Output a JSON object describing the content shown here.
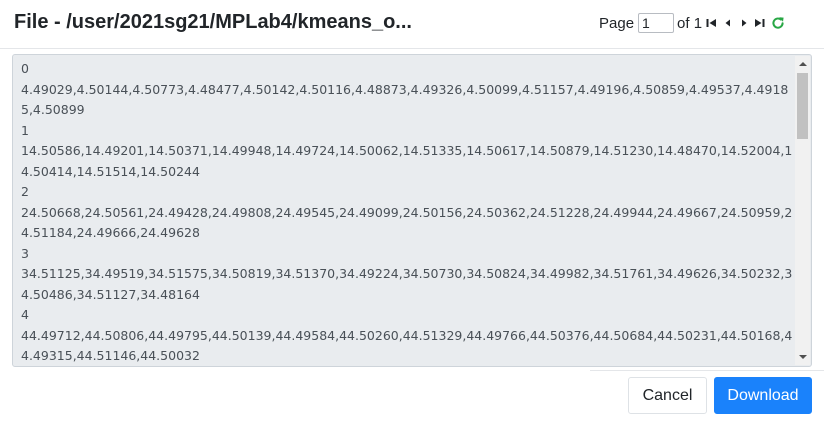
{
  "dialog": {
    "title": "File - /user/2021sg21/MPLab4/kmeans_o..."
  },
  "pager": {
    "page_label": "Page",
    "current_page": "1",
    "of_label": "of 1",
    "icons": [
      "first-page-icon",
      "previous-page-icon",
      "next-page-icon",
      "last-page-icon",
      "refresh-icon"
    ],
    "refresh_color": "#28a745"
  },
  "file_content": {
    "lines": [
      "0",
      "4.49029,4.50144,4.50773,4.48477,4.50142,4.50116,4.48873,4.49326,4.50099,4.51157,4.49196,4.50859,4.49537,4.49185,4.50899",
      "1",
      "14.50586,14.49201,14.50371,14.49948,14.49724,14.50062,14.51335,14.50617,14.50879,14.51230,14.48470,14.52004,14.50414,14.51514,14.50244",
      "2",
      "24.50668,24.50561,24.49428,24.49808,24.49545,24.49099,24.50156,24.50362,24.51228,24.49944,24.49667,24.50959,24.51184,24.49666,24.49628",
      "3",
      "34.51125,34.49519,34.51575,34.50819,34.51370,34.49224,34.50730,34.50824,34.49982,34.51761,34.49626,34.50232,34.50486,34.51127,34.48164",
      "4",
      "44.49712,44.50806,44.49795,44.50139,44.49584,44.50260,44.51329,44.49766,44.50376,44.50684,44.50231,44.50168,44.49315,44.51146,44.50032"
    ]
  },
  "footer": {
    "cancel_label": "Cancel",
    "download_label": "Download"
  },
  "colors": {
    "primary": "#1a82fb",
    "content_background": "#e9ecef"
  }
}
